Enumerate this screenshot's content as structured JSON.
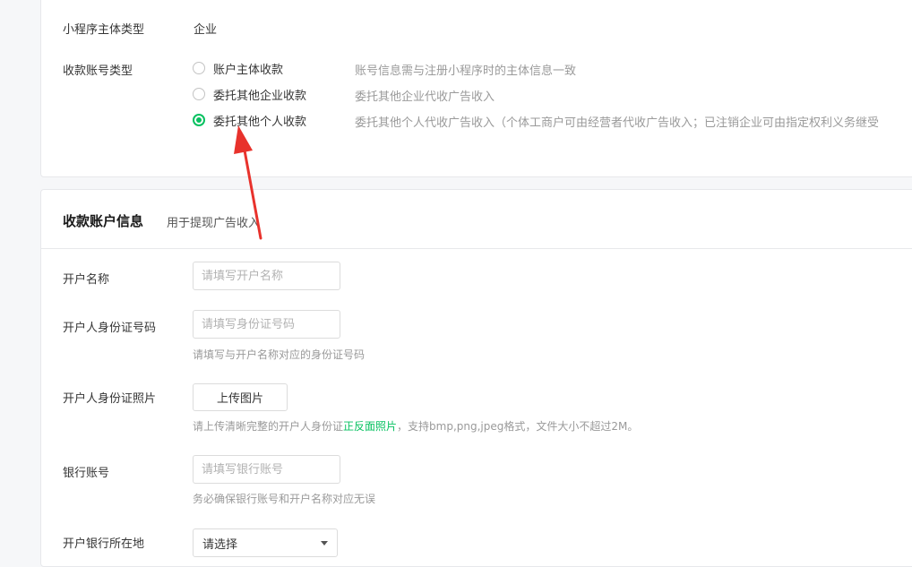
{
  "subject": {
    "label": "小程序主体类型",
    "value": "企业"
  },
  "payment_type": {
    "label": "收款账号类型",
    "options": [
      {
        "label": "账户主体收款",
        "desc": "账号信息需与注册小程序时的主体信息一致",
        "checked": false
      },
      {
        "label": "委托其他企业收款",
        "desc": "委托其他企业代收广告收入",
        "checked": false
      },
      {
        "label": "委托其他个人收款",
        "desc": "委托其他个人代收广告收入（个体工商户可由经营者代收广告收入；已注销企业可由指定权利义务继受",
        "checked": true
      }
    ]
  },
  "account_section": {
    "title": "收款账户信息",
    "subtitle": "用于提现广告收入"
  },
  "fields": {
    "account_name": {
      "label": "开户名称",
      "placeholder": "请填写开户名称"
    },
    "id_number": {
      "label": "开户人身份证号码",
      "placeholder": "请填写身份证号码",
      "hint": "请填写与开户名称对应的身份证号码"
    },
    "id_photo": {
      "label": "开户人身份证照片",
      "button": "上传图片",
      "hint_before": "请上传清晰完整的开户人身份证",
      "hint_link": "正反面照片",
      "hint_after": "，支持bmp,png,jpeg格式，文件大小不超过2M。"
    },
    "bank_account": {
      "label": "银行账号",
      "placeholder": "请填写银行账号",
      "hint": "务必确保银行账号和开户名称对应无误"
    },
    "bank_location": {
      "label": "开户银行所在地",
      "select_value": "请选择"
    }
  },
  "colors": {
    "accent": "#07c160",
    "annotation_arrow": "#e8322c"
  }
}
